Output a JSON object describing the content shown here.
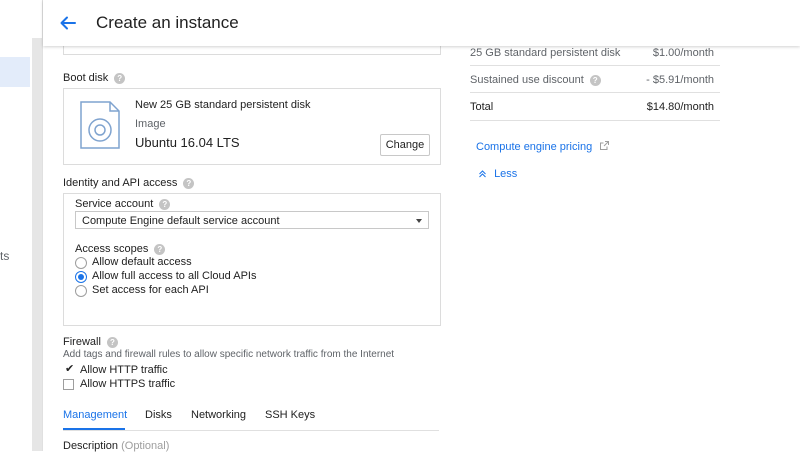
{
  "left_rail": {
    "partial_text": "ts"
  },
  "header": {
    "title": "Create an instance"
  },
  "boot_disk": {
    "label": "Boot disk",
    "disk_title": "New 25 GB standard persistent disk",
    "image_label": "Image",
    "os": "Ubuntu 16.04 LTS",
    "change_label": "Change"
  },
  "identity": {
    "label": "Identity and API access",
    "service_account_label": "Service account",
    "service_account_value": "Compute Engine default service account",
    "access_scopes_label": "Access scopes",
    "scopes": [
      {
        "label": "Allow default access",
        "checked": false
      },
      {
        "label": "Allow full access to all Cloud APIs",
        "checked": true
      },
      {
        "label": "Set access for each API",
        "checked": false
      }
    ]
  },
  "firewall": {
    "label": "Firewall",
    "description": "Add tags and firewall rules to allow specific network traffic from the Internet",
    "options": [
      {
        "label": "Allow HTTP traffic",
        "checked": true
      },
      {
        "label": "Allow HTTPS traffic",
        "checked": false
      }
    ]
  },
  "tabs": [
    {
      "label": "Management",
      "active": true
    },
    {
      "label": "Disks",
      "active": false
    },
    {
      "label": "Networking",
      "active": false
    },
    {
      "label": "SSH Keys",
      "active": false
    }
  ],
  "description_field": {
    "label": "Description",
    "optional": "(Optional)"
  },
  "costs": {
    "rows": [
      {
        "label": "25 GB standard persistent disk",
        "value": "$1.00/month"
      },
      {
        "label": "Sustained use discount",
        "value": "- $5.91/month"
      },
      {
        "label": "Total",
        "value": "$14.80/month"
      }
    ],
    "pricing_link": "Compute engine pricing",
    "less_link": "Less"
  },
  "colors": {
    "accent": "#1a73e8",
    "border": "#dcdcdc",
    "muted_text": "#5f6368"
  }
}
